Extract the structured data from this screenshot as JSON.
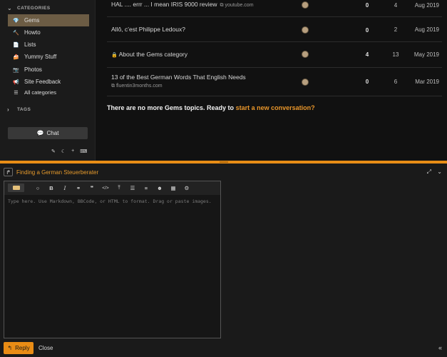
{
  "sidebar": {
    "categories_label": "CATEGORIES",
    "categories": [
      {
        "label": "Gems",
        "icon": "diamond-icon",
        "glyph": "💎",
        "active": true
      },
      {
        "label": "Howto",
        "icon": "hammer-icon",
        "glyph": "🔨"
      },
      {
        "label": "Lists",
        "icon": "document-icon",
        "glyph": "📄"
      },
      {
        "label": "Yummy Stuff",
        "icon": "cake-icon",
        "glyph": "🍰"
      },
      {
        "label": "Photos",
        "icon": "camera-icon",
        "glyph": "📷"
      },
      {
        "label": "Site Feedback",
        "icon": "megaphone-icon",
        "glyph": "📢"
      },
      {
        "label": "All categories",
        "icon": "list-icon",
        "glyph": "☰"
      }
    ],
    "tags_label": "TAGS",
    "chat_label": "Chat",
    "tools": [
      "brush-icon",
      "moon-icon",
      "plus-icon",
      "keyboard-icon"
    ]
  },
  "topics": [
    {
      "title": "HAL .... errr ... I mean IRIS 9000 review",
      "link": "youtube.com",
      "replies": "0",
      "views": "4",
      "date": "Aug 2019"
    },
    {
      "title": "Allô, c’est Philippe Ledoux?",
      "replies": "0",
      "views": "2",
      "date": "Aug 2019"
    },
    {
      "title": "About the Gems category",
      "locked": true,
      "replies": "4",
      "views": "13",
      "date": "May 2019"
    },
    {
      "title": "13 of the Best German Words That English Needs",
      "link": "fluentin3months.com",
      "replies": "0",
      "views": "6",
      "date": "Mar 2019"
    }
  ],
  "no_more": {
    "text": "There are no more Gems topics. Ready to ",
    "cta": "start a new conversation?"
  },
  "composer": {
    "title": "Finding a German Steuerberater",
    "placeholder": "Type here. Use Markdown, BBCode, or HTML to format. Drag or paste images.",
    "toolbar": [
      "keyboard-icon",
      "quote-bubble-icon",
      "bold-icon",
      "italic-icon",
      "link-icon",
      "blockquote-icon",
      "code-icon",
      "upload-icon",
      "bullet-list-icon",
      "numbered-list-icon",
      "emoji-icon",
      "calendar-icon",
      "gear-icon"
    ],
    "reply_label": "Reply",
    "close_label": "Close"
  },
  "colors": {
    "accent": "#e98c15",
    "active_category": "#6c5c44"
  }
}
